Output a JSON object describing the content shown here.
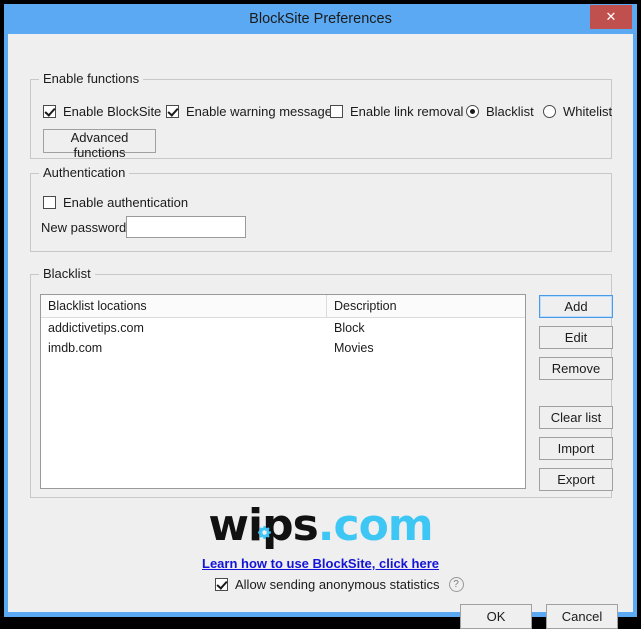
{
  "window": {
    "title": "BlockSite Preferences",
    "close_label": "✕",
    "accent_color": "#5aa9f2",
    "close_color": "#c0504d"
  },
  "enable_functions": {
    "group_title": "Enable functions",
    "checkboxes": [
      {
        "label": "Enable BlockSite",
        "checked": true
      },
      {
        "label": "Enable warning messages",
        "checked": true
      },
      {
        "label": "Enable link removal",
        "checked": false
      }
    ],
    "radios": [
      {
        "label": "Blacklist",
        "selected": true
      },
      {
        "label": "Whitelist",
        "selected": false
      }
    ],
    "advanced_button": "Advanced functions"
  },
  "authentication": {
    "group_title": "Authentication",
    "enable_label": "Enable authentication",
    "enable_checked": false,
    "password_label": "New password",
    "password_value": "",
    "password_placeholder": ""
  },
  "blacklist": {
    "group_title": "Blacklist",
    "columns": [
      "Blacklist locations",
      "Description"
    ],
    "rows": [
      [
        "addictivetips.com",
        "Block"
      ],
      [
        "imdb.com",
        "Movies"
      ]
    ],
    "buttons": [
      {
        "label": "Add",
        "focused": true
      },
      {
        "label": "Edit",
        "focused": false
      },
      {
        "label": "Remove",
        "focused": false
      },
      {
        "label": "Clear list",
        "focused": false
      },
      {
        "label": "Import",
        "focused": false
      },
      {
        "label": "Export",
        "focused": false
      }
    ]
  },
  "branding": {
    "logo_dark": "wips",
    "logo_blue": ".com",
    "logo_dark_color": "#111111",
    "logo_blue_color": "#3ec6f5",
    "gear_color": "#3ec6f5",
    "link_text": "Learn how to use BlockSite, click here",
    "link_color": "#1414d8"
  },
  "footer": {
    "stats_label": "Allow sending anonymous statistics",
    "stats_checked": true,
    "help_glyph": "?",
    "ok_label": "OK",
    "cancel_label": "Cancel"
  }
}
